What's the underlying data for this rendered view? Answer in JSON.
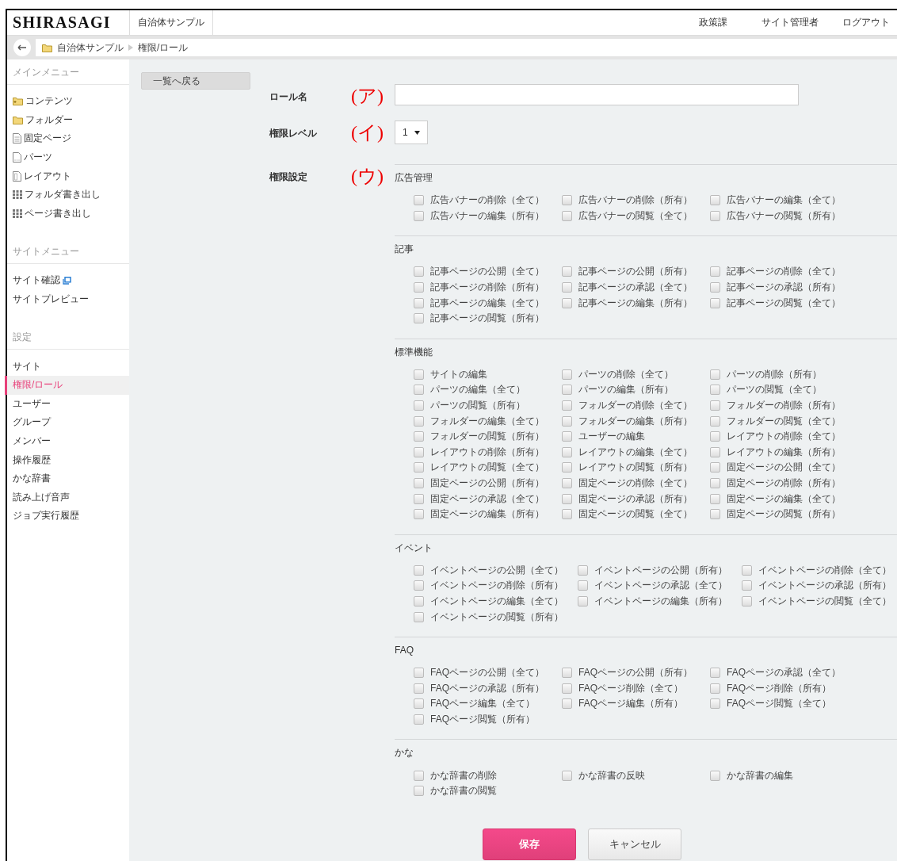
{
  "header": {
    "logo": "SHIRASAGI",
    "site_tab": "自治体サンプル",
    "links": [
      "政策課",
      "サイト管理者",
      "ログアウト"
    ]
  },
  "breadcrumb": {
    "items": [
      "自治体サンプル",
      "権限/ロール"
    ]
  },
  "sidebar": {
    "sections": [
      {
        "title": "メインメニュー",
        "items": [
          {
            "label": "コンテンツ",
            "kind": "folder-plus",
            "selected": false
          },
          {
            "label": "フォルダー",
            "kind": "folder",
            "selected": false
          },
          {
            "label": "固定ページ",
            "kind": "page",
            "selected": false
          },
          {
            "label": "パーツ",
            "kind": "parts",
            "selected": false
          },
          {
            "label": "レイアウト",
            "kind": "layout",
            "selected": false
          },
          {
            "label": "フォルダ書き出し",
            "kind": "grid",
            "selected": false
          },
          {
            "label": "ページ書き出し",
            "kind": "grid",
            "selected": false
          }
        ]
      },
      {
        "title": "サイトメニュー",
        "items": [
          {
            "label": "サイト確認",
            "kind": "external",
            "selected": false
          },
          {
            "label": "サイトプレビュー",
            "kind": "plain",
            "selected": false
          }
        ]
      },
      {
        "title": "設定",
        "items": [
          {
            "label": "サイト",
            "kind": "plain",
            "selected": false
          },
          {
            "label": "権限/ロール",
            "kind": "plain",
            "selected": true
          },
          {
            "label": "ユーザー",
            "kind": "plain",
            "selected": false
          },
          {
            "label": "グループ",
            "kind": "plain",
            "selected": false
          },
          {
            "label": "メンバー",
            "kind": "plain",
            "selected": false
          },
          {
            "label": "操作履歴",
            "kind": "plain",
            "selected": false
          },
          {
            "label": "かな辞書",
            "kind": "plain",
            "selected": false
          },
          {
            "label": "読み上げ音声",
            "kind": "plain",
            "selected": false
          },
          {
            "label": "ジョブ実行履歴",
            "kind": "plain",
            "selected": false
          }
        ]
      }
    ]
  },
  "back_button": "一覧へ戻る",
  "form": {
    "role_name": {
      "label": "ロール名",
      "marker": "(ア)"
    },
    "level": {
      "label": "権限レベル",
      "marker": "(イ)",
      "value": "1"
    },
    "permissions": {
      "label": "権限設定",
      "marker": "(ウ)",
      "groups": [
        {
          "title": "広告管理",
          "items": [
            {
              "label": "広告バナーの削除（全て）",
              "checked": false
            },
            {
              "label": "広告バナーの削除（所有）",
              "checked": false
            },
            {
              "label": "広告バナーの編集（全て）",
              "checked": false
            },
            {
              "label": "広告バナーの編集（所有）",
              "checked": false
            },
            {
              "label": "広告バナーの閲覧（全て）",
              "checked": false
            },
            {
              "label": "広告バナーの閲覧（所有）",
              "checked": false
            }
          ]
        },
        {
          "title": "記事",
          "items": [
            {
              "label": "記事ページの公開（全て）",
              "checked": false
            },
            {
              "label": "記事ページの公開（所有）",
              "checked": false
            },
            {
              "label": "記事ページの削除（全て）",
              "checked": false
            },
            {
              "label": "記事ページの削除（所有）",
              "checked": false
            },
            {
              "label": "記事ページの承認（全て）",
              "checked": false
            },
            {
              "label": "記事ページの承認（所有）",
              "checked": false
            },
            {
              "label": "記事ページの編集（全て）",
              "checked": false
            },
            {
              "label": "記事ページの編集（所有）",
              "checked": false
            },
            {
              "label": "記事ページの閲覧（全て）",
              "checked": false
            },
            {
              "label": "記事ページの閲覧（所有）",
              "checked": false
            }
          ]
        },
        {
          "title": "標準機能",
          "items": [
            {
              "label": "サイトの編集",
              "checked": false
            },
            {
              "label": "パーツの削除（全て）",
              "checked": false
            },
            {
              "label": "パーツの削除（所有）",
              "checked": false
            },
            {
              "label": "パーツの編集（全て）",
              "checked": false
            },
            {
              "label": "パーツの編集（所有）",
              "checked": false
            },
            {
              "label": "パーツの閲覧（全て）",
              "checked": false
            },
            {
              "label": "パーツの閲覧（所有）",
              "checked": false
            },
            {
              "label": "フォルダーの削除（全て）",
              "checked": false
            },
            {
              "label": "フォルダーの削除（所有）",
              "checked": false
            },
            {
              "label": "フォルダーの編集（全て）",
              "checked": false
            },
            {
              "label": "フォルダーの編集（所有）",
              "checked": false
            },
            {
              "label": "フォルダーの閲覧（全て）",
              "checked": false
            },
            {
              "label": "フォルダーの閲覧（所有）",
              "checked": false
            },
            {
              "label": "ユーザーの編集",
              "checked": false
            },
            {
              "label": "レイアウトの削除（全て）",
              "checked": false
            },
            {
              "label": "レイアウトの削除（所有）",
              "checked": false
            },
            {
              "label": "レイアウトの編集（全て）",
              "checked": false
            },
            {
              "label": "レイアウトの編集（所有）",
              "checked": false
            },
            {
              "label": "レイアウトの閲覧（全て）",
              "checked": false
            },
            {
              "label": "レイアウトの閲覧（所有）",
              "checked": false
            },
            {
              "label": "固定ページの公開（全て）",
              "checked": false
            },
            {
              "label": "固定ページの公開（所有）",
              "checked": false
            },
            {
              "label": "固定ページの削除（全て）",
              "checked": false
            },
            {
              "label": "固定ページの削除（所有）",
              "checked": false
            },
            {
              "label": "固定ページの承認（全て）",
              "checked": false
            },
            {
              "label": "固定ページの承認（所有）",
              "checked": false
            },
            {
              "label": "固定ページの編集（全て）",
              "checked": false
            },
            {
              "label": "固定ページの編集（所有）",
              "checked": false
            },
            {
              "label": "固定ページの閲覧（全て）",
              "checked": false
            },
            {
              "label": "固定ページの閲覧（所有）",
              "checked": false
            }
          ]
        },
        {
          "title": "イベント",
          "items": [
            {
              "label": "イベントページの公開（全て）",
              "checked": false
            },
            {
              "label": "イベントページの公開（所有）",
              "checked": false
            },
            {
              "label": "イベントページの削除（全て）",
              "checked": false
            },
            {
              "label": "イベントページの削除（所有）",
              "checked": false
            },
            {
              "label": "イベントページの承認（全て）",
              "checked": false
            },
            {
              "label": "イベントページの承認（所有）",
              "checked": false
            },
            {
              "label": "イベントページの編集（全て）",
              "checked": false
            },
            {
              "label": "イベントページの編集（所有）",
              "checked": false
            },
            {
              "label": "イベントページの閲覧（全て）",
              "checked": false
            },
            {
              "label": "イベントページの閲覧（所有）",
              "checked": false
            }
          ]
        },
        {
          "title": "FAQ",
          "items": [
            {
              "label": "FAQページの公開（全て）",
              "checked": false
            },
            {
              "label": "FAQページの公開（所有）",
              "checked": false
            },
            {
              "label": "FAQページの承認（全て）",
              "checked": false
            },
            {
              "label": "FAQページの承認（所有）",
              "checked": false
            },
            {
              "label": "FAQページ削除（全て）",
              "checked": false
            },
            {
              "label": "FAQページ削除（所有）",
              "checked": false
            },
            {
              "label": "FAQページ編集（全て）",
              "checked": false
            },
            {
              "label": "FAQページ編集（所有）",
              "checked": false
            },
            {
              "label": "FAQページ閲覧（全て）",
              "checked": false
            },
            {
              "label": "FAQページ閲覧（所有）",
              "checked": false
            }
          ]
        },
        {
          "title": "かな",
          "items": [
            {
              "label": "かな辞書の削除",
              "checked": false
            },
            {
              "label": "かな辞書の反映",
              "checked": false
            },
            {
              "label": "かな辞書の編集",
              "checked": false
            },
            {
              "label": "かな辞書の閲覧",
              "checked": false
            }
          ]
        }
      ]
    }
  },
  "buttons": [
    {
      "label": "保存",
      "kind": "primary"
    },
    {
      "label": "キャンセル",
      "kind": "secondary"
    }
  ]
}
